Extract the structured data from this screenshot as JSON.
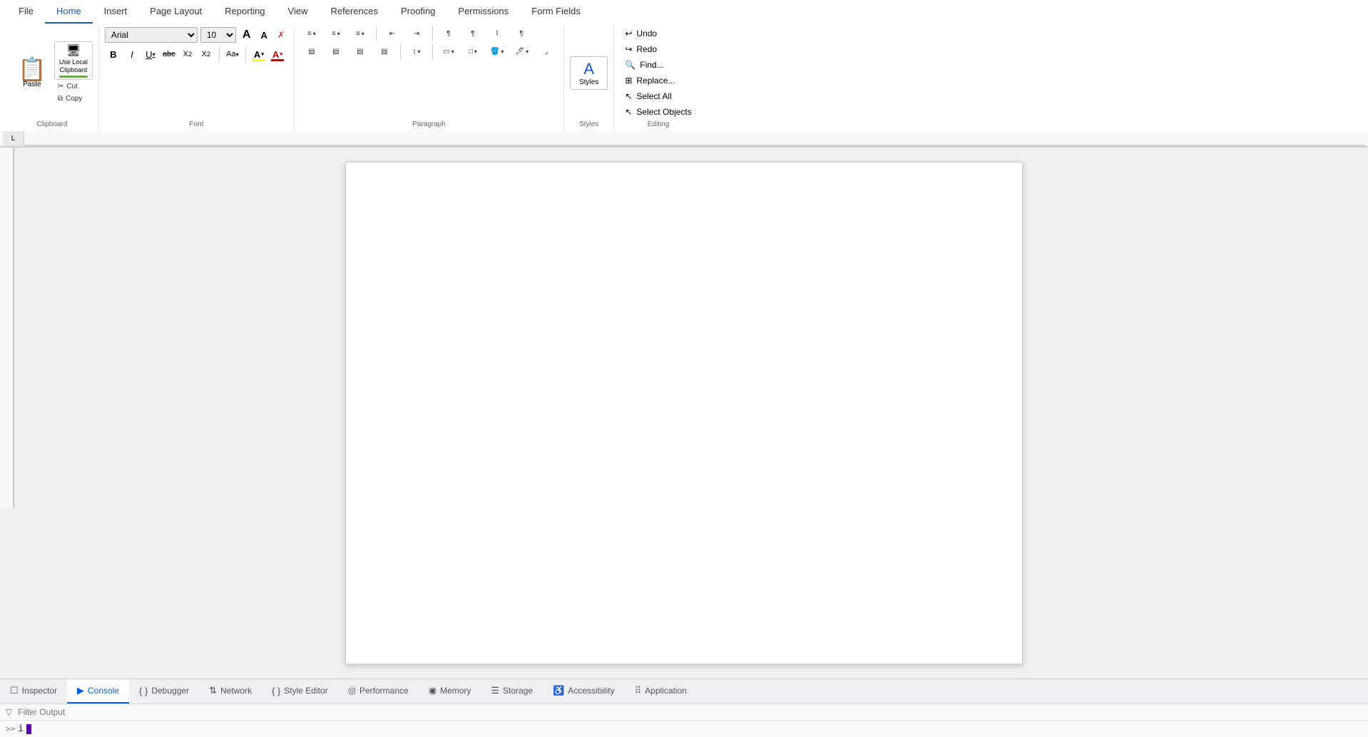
{
  "tabs": {
    "items": [
      "File",
      "Home",
      "Insert",
      "Page Layout",
      "Reporting",
      "View",
      "References",
      "Proofing",
      "Permissions",
      "Form Fields"
    ],
    "active": "Home"
  },
  "clipboard": {
    "paste_label": "Paste",
    "use_local_label": "Use Local\nClipboard",
    "cut_label": "Cut",
    "copy_label": "Copy",
    "group_label": "Clipboard"
  },
  "font": {
    "family": "Arial",
    "size": "10",
    "group_label": "Font",
    "bold": "B",
    "italic": "I",
    "underline": "U",
    "strikethrough": "abc",
    "subscript": "X₂",
    "superscript": "X²",
    "change_case": "Aa",
    "grow": "A",
    "shrink": "A",
    "clear": "✗"
  },
  "paragraph": {
    "group_label": "Paragraph",
    "group_expand": "⌟"
  },
  "styles": {
    "label": "Styles",
    "group_label": "Styles"
  },
  "editing": {
    "undo_label": "Undo",
    "redo_label": "Redo",
    "find_label": "Find...",
    "replace_label": "Replace...",
    "select_all_label": "Select All",
    "select_objects_label": "Select Objects",
    "group_label": "Editing"
  },
  "devtools": {
    "tabs": [
      {
        "id": "inspector",
        "label": "Inspector",
        "icon": "☐"
      },
      {
        "id": "console",
        "label": "Console",
        "icon": "▶"
      },
      {
        "id": "debugger",
        "label": "Debugger",
        "icon": "{}"
      },
      {
        "id": "network",
        "label": "Network",
        "icon": "⇅"
      },
      {
        "id": "style-editor",
        "label": "Style Editor",
        "icon": "{}"
      },
      {
        "id": "performance",
        "label": "Performance",
        "icon": "◎"
      },
      {
        "id": "memory",
        "label": "Memory",
        "icon": "◉"
      },
      {
        "id": "storage",
        "label": "Storage",
        "icon": "☰"
      },
      {
        "id": "accessibility",
        "label": "Accessibility",
        "icon": "♿"
      },
      {
        "id": "application",
        "label": "Application",
        "icon": "⠿"
      }
    ],
    "active": "console",
    "filter_placeholder": "Filter Output",
    "console_text": "i"
  }
}
